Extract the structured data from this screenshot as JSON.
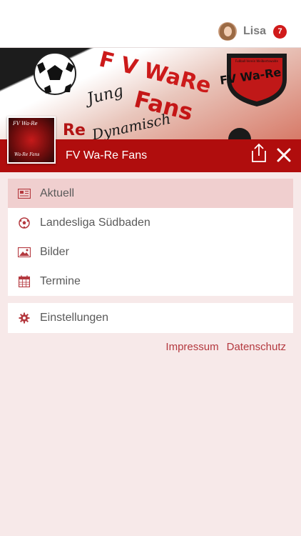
{
  "user": {
    "name": "Lisa",
    "notification_count": "7"
  },
  "banner": {
    "text_line1": "F V WaRe",
    "text_line2": "Fans",
    "text_jung": "Jung",
    "text_dynamisch": "Dynamisch",
    "crest_text": "FV Wa-Re",
    "crest_caption": "Fußball-Verein Weilbertswaldes Bergenswalde 1996 e.V."
  },
  "header": {
    "title": "FV Wa-Re Fans",
    "thumb_line1": "FV Wa-Re",
    "thumb_line2": "Wa-Re Fans"
  },
  "menu": {
    "items": [
      {
        "label": "Aktuell",
        "icon": "newspaper-icon"
      },
      {
        "label": "Landesliga Südbaden",
        "icon": "soccer-ball-icon"
      },
      {
        "label": "Bilder",
        "icon": "image-icon"
      },
      {
        "label": "Termine",
        "icon": "calendar-icon"
      }
    ],
    "settings_label": "Einstellungen"
  },
  "footer": {
    "impressum": "Impressum",
    "datenschutz": "Datenschutz"
  },
  "colors": {
    "brand_red": "#b00d0d",
    "accent_link": "#b4393f",
    "background": "#f7e9e9"
  }
}
